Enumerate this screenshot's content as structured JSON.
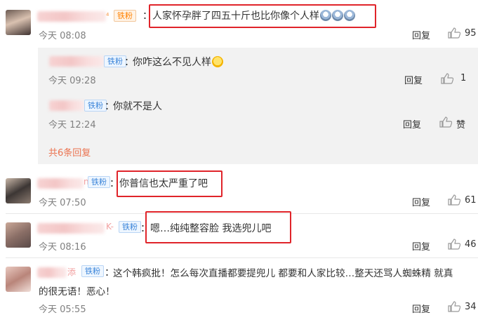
{
  "comments": [
    {
      "text": "人家怀孕胖了四五十斤也比你像个人样",
      "time": "今天 08:08",
      "reply_label": "回复",
      "likes": "95",
      "fan_badge": "铁粉"
    },
    {
      "text": "你普信也太严重了吧",
      "time": "今天 07:50",
      "reply_label": "回复",
      "likes": "61",
      "fan_badge": "铁粉",
      "name_suffix": "n"
    },
    {
      "text": "嗯…纯纯整容脸 我选兜儿吧",
      "time": "今天 08:16",
      "reply_label": "回复",
      "likes": "46",
      "fan_badge": "铁粉",
      "name_suffix": "K-"
    },
    {
      "text_line1": "这个韩疯批！怎么每次直播都要提兜儿 都要和人家比较…整天还骂人蜘蛛精 就真",
      "text_line2": "的很无语！恶心！",
      "time": "今天 05:55",
      "reply_label": "回复",
      "likes": "34",
      "fan_badge": "铁粉",
      "name_suffix": "添"
    }
  ],
  "replies": [
    {
      "text": "你咋这么不见人样",
      "time": "今天 09:28",
      "reply_label": "回复",
      "likes": "1",
      "fan_badge": "铁粉"
    },
    {
      "text": "你就不是人",
      "time": "今天 12:24",
      "reply_label": "回复",
      "likes": "赞",
      "fan_badge": "铁粉"
    }
  ],
  "more_replies": "共6条回复",
  "separator": "："
}
